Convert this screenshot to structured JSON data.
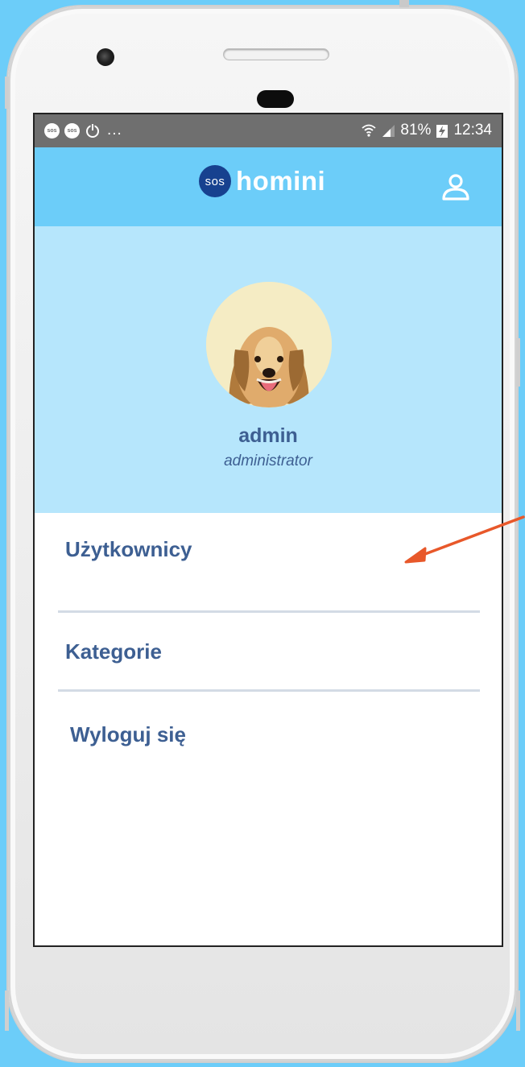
{
  "status_bar": {
    "notifications": [
      "sos",
      "sos"
    ],
    "more": "...",
    "battery": "81%",
    "time": "12:34"
  },
  "header": {
    "logo_badge": "sos",
    "logo_text": "homini"
  },
  "profile": {
    "name": "admin",
    "role": "administrator"
  },
  "menu": {
    "items": [
      {
        "label": "Użytkownicy"
      },
      {
        "label": "Kategorie"
      },
      {
        "label": "Wyloguj się"
      }
    ]
  },
  "colors": {
    "background": "#6ccdf9",
    "header": "#6ccdf9",
    "profile_bg": "#b6e6fc",
    "brand_dark": "#17418f",
    "text": "#3d5f92",
    "arrow": "#e8582a"
  },
  "icons": {
    "status": [
      "sos-notification-icon",
      "sos-notification-icon",
      "power-icon",
      "wifi-icon",
      "signal-icon",
      "battery-charging-icon"
    ],
    "header": [
      "user-icon"
    ]
  }
}
